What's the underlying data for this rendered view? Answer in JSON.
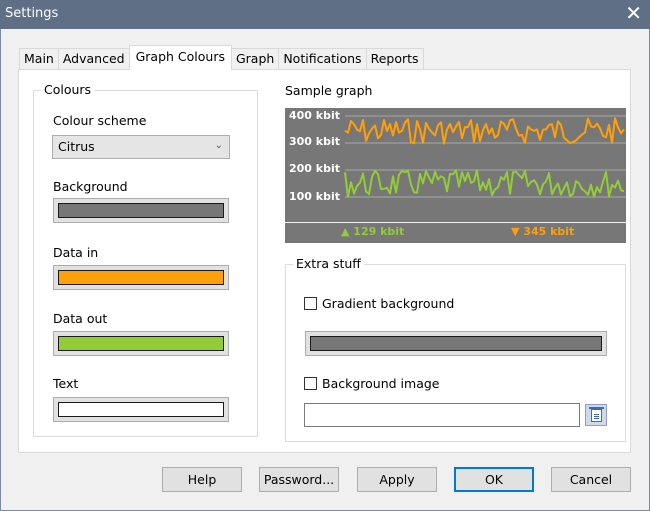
{
  "window": {
    "title": "Settings",
    "close_icon": "close-icon"
  },
  "tabs": [
    {
      "label": "Main",
      "active": false
    },
    {
      "label": "Advanced",
      "active": false
    },
    {
      "label": "Graph Colours",
      "active": true
    },
    {
      "label": "Graph",
      "active": false
    },
    {
      "label": "Notifications",
      "active": false
    },
    {
      "label": "Reports",
      "active": false
    }
  ],
  "colours": {
    "legend": "Colours",
    "scheme_label": "Colour scheme",
    "scheme_value": "Citrus",
    "background_label": "Background",
    "background_color": "#777777",
    "data_in_label": "Data in",
    "data_in_color": "#ffa00a",
    "data_out_label": "Data out",
    "data_out_color": "#92cc37",
    "text_label": "Text",
    "text_color": "#ffffff"
  },
  "sample_graph": {
    "title": "Sample graph",
    "axis_labels": [
      "400 kbit",
      "300 kbit",
      "200 kbit",
      "100 kbit"
    ],
    "upload_stat": "▲ 129 kbit",
    "download_stat": "▼ 345 kbit",
    "upload_color": "#92cc37",
    "download_color": "#ffa00a"
  },
  "extra": {
    "legend": "Extra stuff",
    "gradient_label": "Gradient background",
    "gradient_checked": false,
    "gradient_color": "#777777",
    "bg_image_label": "Background image",
    "bg_image_checked": false,
    "bg_image_path": "",
    "browse_icon": "browse-file-icon"
  },
  "buttons": {
    "help": "Help",
    "password": "Password...",
    "apply": "Apply",
    "ok": "OK",
    "cancel": "Cancel"
  }
}
